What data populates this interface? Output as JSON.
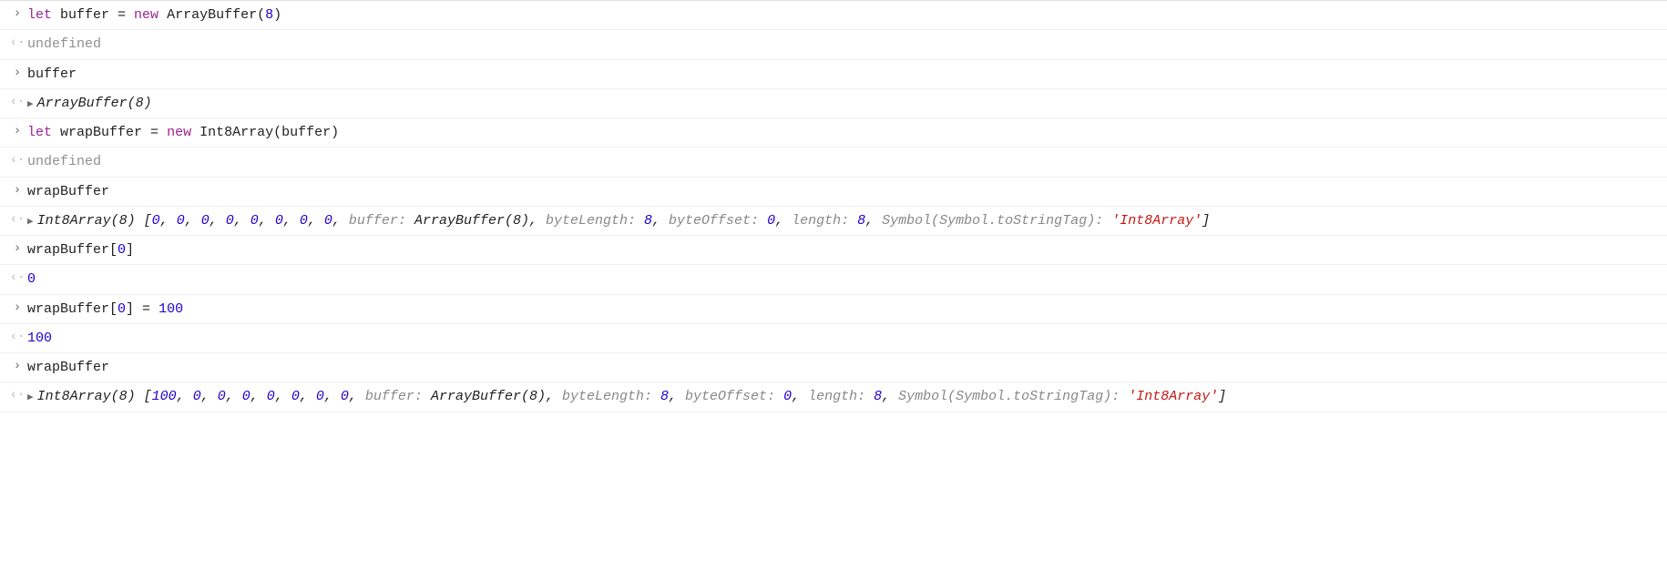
{
  "gutter": {
    "input": "›",
    "output": "‹·",
    "expander": "▶"
  },
  "rows": [
    {
      "kind": "in",
      "tokens": [
        {
          "t": "let ",
          "c": "tok-kw"
        },
        {
          "t": "buffer ",
          "c": "tok-id"
        },
        {
          "t": "= ",
          "c": "tok-pun"
        },
        {
          "t": "new ",
          "c": "tok-kw"
        },
        {
          "t": "ArrayBuffer",
          "c": "tok-id"
        },
        {
          "t": "(",
          "c": "tok-pun"
        },
        {
          "t": "8",
          "c": "tok-num"
        },
        {
          "t": ")",
          "c": "tok-pun"
        }
      ]
    },
    {
      "kind": "out",
      "tokens": [
        {
          "t": "undefined",
          "c": "tok-undef"
        }
      ]
    },
    {
      "kind": "in",
      "tokens": [
        {
          "t": "buffer",
          "c": "tok-id"
        }
      ]
    },
    {
      "kind": "out",
      "expandable": true,
      "tokens": [
        {
          "t": "ArrayBuffer(8)",
          "c": "tok-objtype"
        }
      ]
    },
    {
      "kind": "in",
      "tokens": [
        {
          "t": "let ",
          "c": "tok-kw"
        },
        {
          "t": "wrapBuffer ",
          "c": "tok-id"
        },
        {
          "t": "= ",
          "c": "tok-pun"
        },
        {
          "t": "new ",
          "c": "tok-kw"
        },
        {
          "t": "Int8Array",
          "c": "tok-id"
        },
        {
          "t": "(",
          "c": "tok-pun"
        },
        {
          "t": "buffer",
          "c": "tok-id"
        },
        {
          "t": ")",
          "c": "tok-pun"
        }
      ]
    },
    {
      "kind": "out",
      "tokens": [
        {
          "t": "undefined",
          "c": "tok-undef"
        }
      ]
    },
    {
      "kind": "in",
      "tokens": [
        {
          "t": "wrapBuffer",
          "c": "tok-id"
        }
      ]
    },
    {
      "kind": "out",
      "expandable": true,
      "tokens": [
        {
          "t": "Int8Array(8) ",
          "c": "tok-objtype"
        },
        {
          "t": "[",
          "c": "italic"
        },
        {
          "t": "0",
          "c": "tok-num italic"
        },
        {
          "t": ", ",
          "c": "italic"
        },
        {
          "t": "0",
          "c": "tok-num italic"
        },
        {
          "t": ", ",
          "c": "italic"
        },
        {
          "t": "0",
          "c": "tok-num italic"
        },
        {
          "t": ", ",
          "c": "italic"
        },
        {
          "t": "0",
          "c": "tok-num italic"
        },
        {
          "t": ", ",
          "c": "italic"
        },
        {
          "t": "0",
          "c": "tok-num italic"
        },
        {
          "t": ", ",
          "c": "italic"
        },
        {
          "t": "0",
          "c": "tok-num italic"
        },
        {
          "t": ", ",
          "c": "italic"
        },
        {
          "t": "0",
          "c": "tok-num italic"
        },
        {
          "t": ", ",
          "c": "italic"
        },
        {
          "t": "0",
          "c": "tok-num italic"
        },
        {
          "t": ", ",
          "c": "italic"
        },
        {
          "t": "buffer: ",
          "c": "tok-grey"
        },
        {
          "t": "ArrayBuffer(8)",
          "c": "italic"
        },
        {
          "t": ", ",
          "c": "italic"
        },
        {
          "t": "byteLength: ",
          "c": "tok-grey"
        },
        {
          "t": "8",
          "c": "tok-num italic"
        },
        {
          "t": ", ",
          "c": "italic"
        },
        {
          "t": "byteOffset: ",
          "c": "tok-grey"
        },
        {
          "t": "0",
          "c": "tok-num italic"
        },
        {
          "t": ", ",
          "c": "italic"
        },
        {
          "t": "length: ",
          "c": "tok-grey"
        },
        {
          "t": "8",
          "c": "tok-num italic"
        },
        {
          "t": ", ",
          "c": "italic"
        },
        {
          "t": "Symbol(Symbol.toStringTag): ",
          "c": "tok-grey"
        },
        {
          "t": "'Int8Array'",
          "c": "tok-str italic"
        },
        {
          "t": "]",
          "c": "italic"
        }
      ]
    },
    {
      "kind": "in",
      "tokens": [
        {
          "t": "wrapBuffer",
          "c": "tok-id"
        },
        {
          "t": "[",
          "c": "tok-pun"
        },
        {
          "t": "0",
          "c": "tok-num"
        },
        {
          "t": "]",
          "c": "tok-pun"
        }
      ]
    },
    {
      "kind": "out",
      "tokens": [
        {
          "t": "0",
          "c": "tok-num"
        }
      ]
    },
    {
      "kind": "in",
      "tokens": [
        {
          "t": "wrapBuffer",
          "c": "tok-id"
        },
        {
          "t": "[",
          "c": "tok-pun"
        },
        {
          "t": "0",
          "c": "tok-num"
        },
        {
          "t": "] = ",
          "c": "tok-pun"
        },
        {
          "t": "100",
          "c": "tok-num"
        }
      ]
    },
    {
      "kind": "out",
      "tokens": [
        {
          "t": "100",
          "c": "tok-num"
        }
      ]
    },
    {
      "kind": "in",
      "tokens": [
        {
          "t": "wrapBuffer",
          "c": "tok-id"
        }
      ]
    },
    {
      "kind": "out",
      "expandable": true,
      "tokens": [
        {
          "t": "Int8Array(8) ",
          "c": "tok-objtype"
        },
        {
          "t": "[",
          "c": "italic"
        },
        {
          "t": "100",
          "c": "tok-num italic"
        },
        {
          "t": ", ",
          "c": "italic"
        },
        {
          "t": "0",
          "c": "tok-num italic"
        },
        {
          "t": ", ",
          "c": "italic"
        },
        {
          "t": "0",
          "c": "tok-num italic"
        },
        {
          "t": ", ",
          "c": "italic"
        },
        {
          "t": "0",
          "c": "tok-num italic"
        },
        {
          "t": ", ",
          "c": "italic"
        },
        {
          "t": "0",
          "c": "tok-num italic"
        },
        {
          "t": ", ",
          "c": "italic"
        },
        {
          "t": "0",
          "c": "tok-num italic"
        },
        {
          "t": ", ",
          "c": "italic"
        },
        {
          "t": "0",
          "c": "tok-num italic"
        },
        {
          "t": ", ",
          "c": "italic"
        },
        {
          "t": "0",
          "c": "tok-num italic"
        },
        {
          "t": ", ",
          "c": "italic"
        },
        {
          "t": "buffer: ",
          "c": "tok-grey"
        },
        {
          "t": "ArrayBuffer(8)",
          "c": "italic"
        },
        {
          "t": ", ",
          "c": "italic"
        },
        {
          "t": "byteLength: ",
          "c": "tok-grey"
        },
        {
          "t": "8",
          "c": "tok-num italic"
        },
        {
          "t": ", ",
          "c": "italic"
        },
        {
          "t": "byteOffset: ",
          "c": "tok-grey"
        },
        {
          "t": "0",
          "c": "tok-num italic"
        },
        {
          "t": ", ",
          "c": "italic"
        },
        {
          "t": "length: ",
          "c": "tok-grey"
        },
        {
          "t": "8",
          "c": "tok-num italic"
        },
        {
          "t": ", ",
          "c": "italic"
        },
        {
          "t": "Symbol(Symbol.toStringTag): ",
          "c": "tok-grey"
        },
        {
          "t": "'Int8Array'",
          "c": "tok-str italic"
        },
        {
          "t": "]",
          "c": "italic"
        }
      ]
    }
  ]
}
